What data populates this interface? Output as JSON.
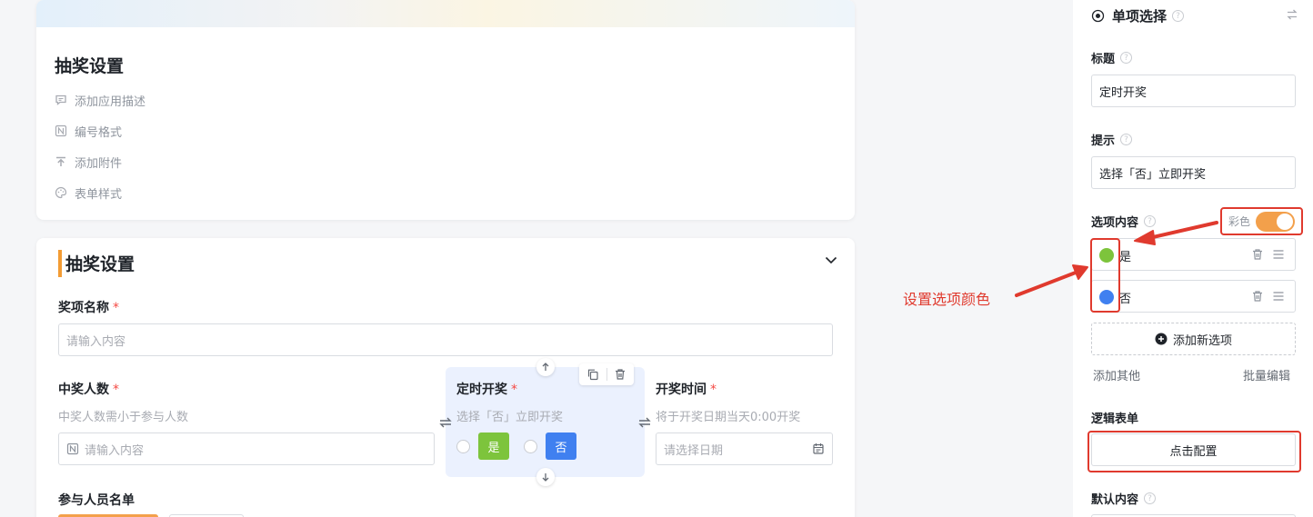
{
  "settings_card": {
    "title": "抽奖设置",
    "options": [
      {
        "label": "添加应用描述",
        "icon": "comment-icon"
      },
      {
        "label": "编号格式",
        "icon": "number-format-icon"
      },
      {
        "label": "添加附件",
        "icon": "upload-icon"
      },
      {
        "label": "表单样式",
        "icon": "palette-icon"
      }
    ]
  },
  "form_section": {
    "title": "抽奖设置",
    "prize_name": {
      "label": "奖项名称",
      "required": "*",
      "placeholder": "请输入内容"
    },
    "winner_count": {
      "label": "中奖人数",
      "required": "*",
      "hint": "中奖人数需小于参与人数",
      "placeholder": "请输入内容"
    },
    "timed_draw": {
      "label": "定时开奖",
      "required": "*",
      "hint": "选择「否」立即开奖",
      "options": [
        "是",
        "否"
      ],
      "option_colors": [
        "#7dc43c",
        "#4080f0"
      ]
    },
    "draw_time": {
      "label": "开奖时间",
      "required": "*",
      "hint": "将于开奖日期当天0:00开奖",
      "placeholder": "请选择日期"
    },
    "participants": {
      "label": "参与人员名单"
    }
  },
  "right_panel": {
    "header": "单项选择",
    "title_label": "标题",
    "title_value": "定时开奖",
    "hint_label": "提示",
    "hint_value": "选择「否」立即开奖",
    "options_label": "选项内容",
    "color_toggle_label": "彩色",
    "color_toggle_on": true,
    "options": [
      {
        "label": "是",
        "color": "#7dc43c"
      },
      {
        "label": "否",
        "color": "#4080f0"
      }
    ],
    "add_option": "添加新选项",
    "add_other": "添加其他",
    "batch_edit": "批量编辑",
    "logic_label": "逻辑表单",
    "configure_button": "点击配置",
    "default_label": "默认内容"
  },
  "annotation": {
    "text": "设置选项颜色",
    "color": "#e03a2e"
  }
}
